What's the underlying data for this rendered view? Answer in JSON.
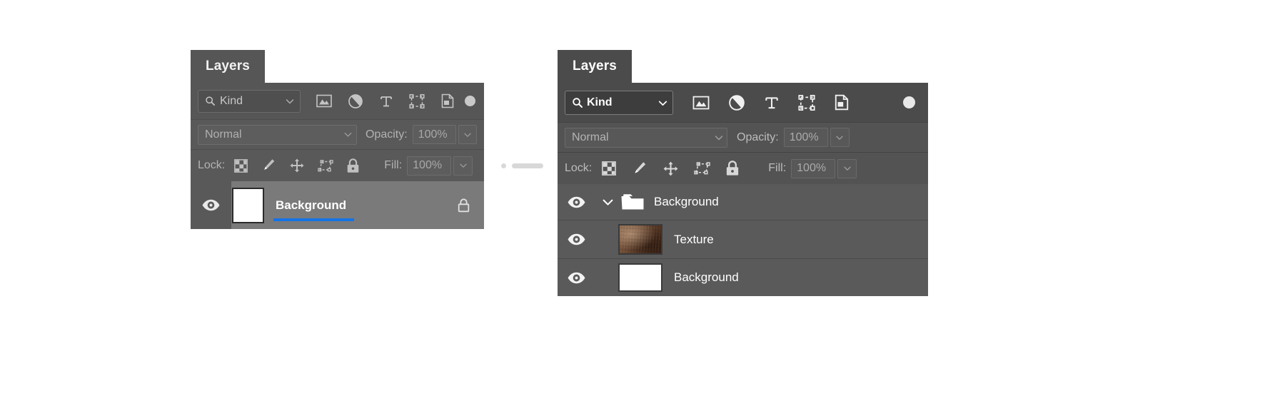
{
  "panels": {
    "left": {
      "tab_label": "Layers",
      "filter": {
        "kind_label": "Kind",
        "search_icon": "search-icon",
        "chevron_icon": "chevron-down-icon",
        "filter_icons": [
          "pixel-layer-filter-icon",
          "adjustment-layer-filter-icon",
          "type-layer-filter-icon",
          "shape-layer-filter-icon",
          "smart-object-filter-icon"
        ],
        "toggle_icon": "filter-toggle-switch"
      },
      "blend": {
        "mode": "Normal",
        "opacity_label": "Opacity:",
        "opacity_value": "100%"
      },
      "lock": {
        "label": "Lock:",
        "icons": [
          "lock-transparent-pixels-icon",
          "lock-image-pixels-icon",
          "lock-position-icon",
          "lock-artboard-nesting-icon",
          "lock-all-icon"
        ],
        "fill_label": "Fill:",
        "fill_value": "100%"
      },
      "layers": [
        {
          "name": "Background",
          "visible": true,
          "eye_icon": "eye-icon",
          "thumb": "white-thumbnail",
          "locked": true,
          "lock_icon": "lock-icon",
          "selected": true,
          "highlight_color": "#1473e6"
        }
      ]
    },
    "right": {
      "tab_label": "Layers",
      "filter": {
        "kind_label": "Kind",
        "search_icon": "search-icon",
        "chevron_icon": "chevron-down-icon",
        "filter_icons": [
          "pixel-layer-filter-icon",
          "adjustment-layer-filter-icon",
          "type-layer-filter-icon",
          "shape-layer-filter-icon",
          "smart-object-filter-icon"
        ],
        "toggle_icon": "filter-toggle-switch"
      },
      "blend": {
        "mode": "Normal",
        "opacity_label": "Opacity:",
        "opacity_value": "100%"
      },
      "lock": {
        "label": "Lock:",
        "icons": [
          "lock-transparent-pixels-icon",
          "lock-image-pixels-icon",
          "lock-position-icon",
          "lock-artboard-nesting-icon",
          "lock-all-icon"
        ],
        "fill_label": "Fill:",
        "fill_value": "100%"
      },
      "layers": [
        {
          "name": "Background",
          "visible": true,
          "eye_icon": "eye-icon",
          "type": "group",
          "expanded": true,
          "disclosure_icon": "chevron-down-icon",
          "thumb": "folder-icon",
          "indent": 0
        },
        {
          "name": "Texture",
          "visible": true,
          "eye_icon": "eye-icon",
          "type": "pixel",
          "thumb": "texture-thumbnail",
          "indent": 1
        },
        {
          "name": "Background",
          "visible": true,
          "eye_icon": "eye-icon",
          "type": "pixel",
          "thumb": "white-thumbnail",
          "indent": 1
        }
      ]
    }
  },
  "connector": {
    "dot_icon": "connector-dot",
    "bar_icon": "connector-bar"
  },
  "colors": {
    "panel_bg_left": "#595959",
    "panel_bg_right": "#535353",
    "tab_bg_left": "#565656",
    "tab_bg_right": "#4b4b4b",
    "selected_layer_bg": "#7a7a7a",
    "layer_row_bg": "#5a5a5a",
    "accent_blue": "#1473e6",
    "texture_brown": "#6b4a34"
  }
}
